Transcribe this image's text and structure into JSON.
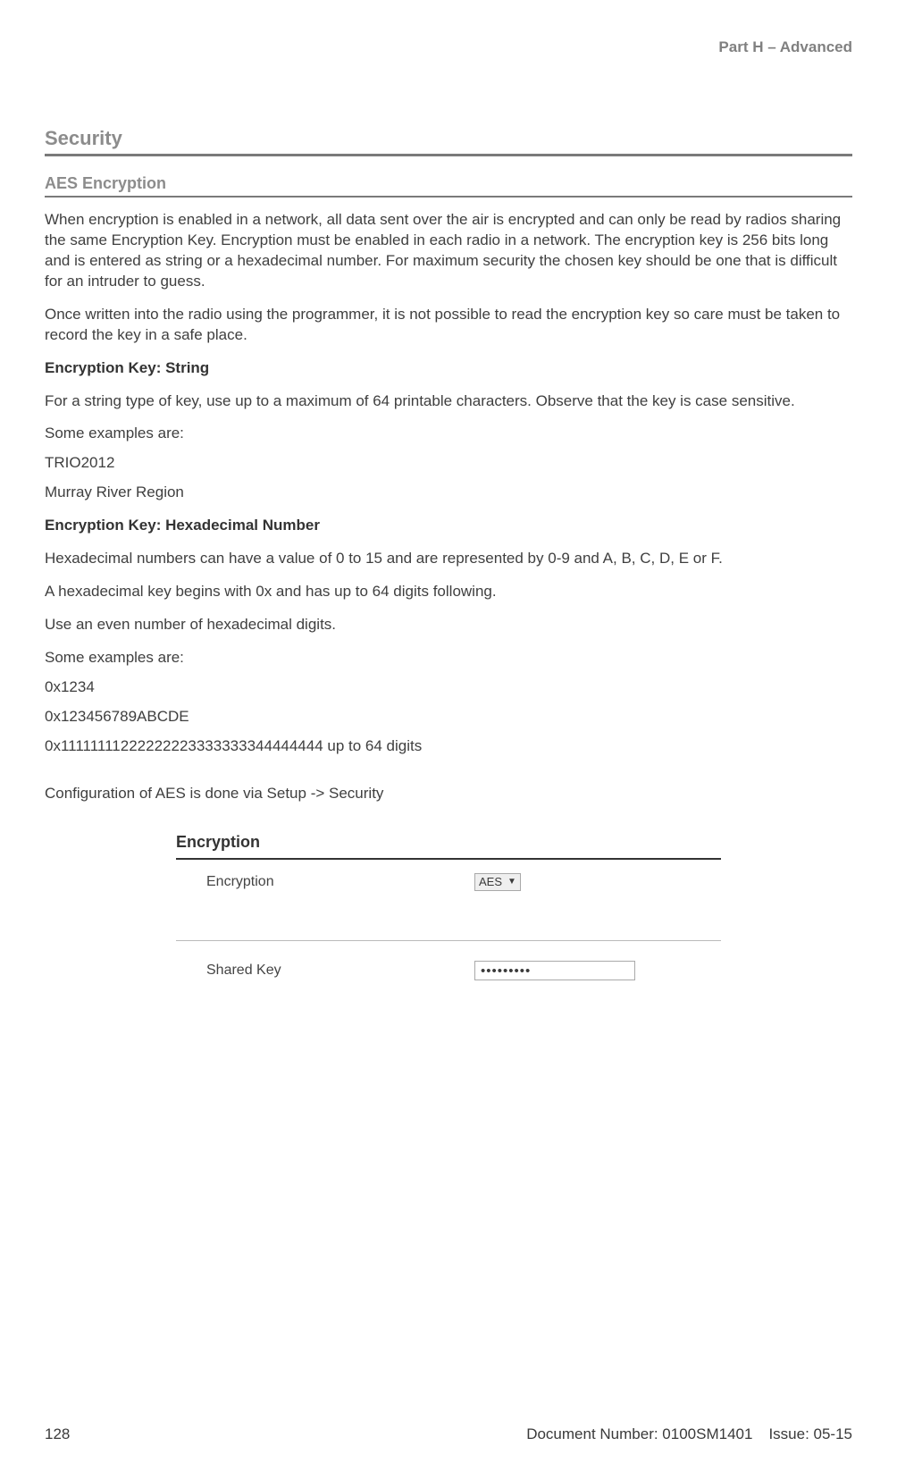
{
  "header": {
    "part_label": "Part H – Advanced"
  },
  "h1": "Security",
  "h2": "AES Encryption",
  "paras": {
    "p1": "When encryption is enabled in a network, all data sent over the air is encrypted and can only be read by radios sharing the same Encryption Key. Encryption must be enabled in each radio in a network. The encryption key is 256 bits long and is entered as string or a hexadecimal number. For maximum security the chosen key should be one that is difficult for an intruder to guess.",
    "p2": "Once written into the radio using the programmer, it is not possible to read the encryption key so care must be taken to record the key in a safe place.",
    "b1": "Encryption Key: String",
    "p3": "For a string type of key, use up to a maximum of 64 printable characters. Observe that the key is case sensitive.",
    "p4": "Some examples are:",
    "p5": "TRIO2012",
    "p6": "Murray River Region",
    "b2": "Encryption Key: Hexadecimal Number",
    "p7": "Hexadecimal numbers can have a value of 0 to 15 and are represented by 0-9 and A, B, C, D, E or F.",
    "p8": "A hexadecimal key begins with 0x and has up to 64 digits following.",
    "p9": "Use an even number of hexadecimal digits.",
    "p10": "Some examples are:",
    "p11": "0x1234",
    "p12": "0x123456789ABCDE",
    "p13": "0x11111111222222223333333344444444 up to 64 digits",
    "p14": "Configuration of AES is done via Setup -> Security"
  },
  "config_panel": {
    "title": "Encryption",
    "row1_label": "Encryption",
    "row1_value": "AES",
    "row2_label": "Shared Key",
    "row2_value": "•••••••••"
  },
  "footer": {
    "page_number": "128",
    "doc_number": "Document Number: 0100SM1401",
    "issue": "Issue: 05-15"
  }
}
